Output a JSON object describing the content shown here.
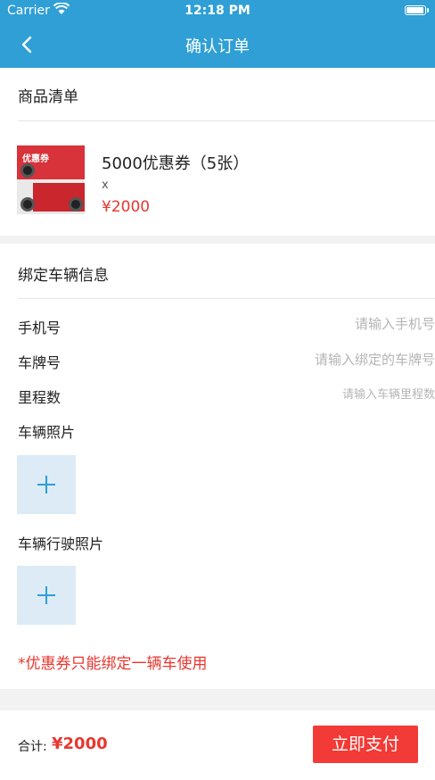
{
  "status_bar": {
    "carrier": "Carrier",
    "time": "12:18 PM",
    "battery_level": 1.0
  },
  "nav": {
    "title": "确认订单",
    "back_icon": "chevron-left-icon"
  },
  "product_section": {
    "title": "商品清单",
    "item": {
      "name": "5000优惠券（5张）",
      "quantity": "x",
      "price": "¥2000",
      "thumbnail_text": "优惠券"
    }
  },
  "vehicle_section": {
    "title": "绑定车辆信息",
    "phone": {
      "label": "手机号",
      "placeholder": "请输入手机号"
    },
    "plate": {
      "label": "车牌号",
      "placeholder": "请输入绑定的车牌号"
    },
    "mileage": {
      "label": "里程数",
      "placeholder": "请输入车辆里程数"
    },
    "car_photo": {
      "label": "车辆照片",
      "icon": "plus-icon"
    },
    "license_photo": {
      "label": "车辆行驶照片",
      "icon": "plus-icon"
    },
    "notice": "*优惠券只能绑定一辆车使用"
  },
  "footer": {
    "total_label": "合计:",
    "total_value": "¥2000",
    "pay_button": "立即支付"
  },
  "colors": {
    "header": "#2f9fd6",
    "accent_red": "#e8372f",
    "pay_button": "#f23a36"
  }
}
